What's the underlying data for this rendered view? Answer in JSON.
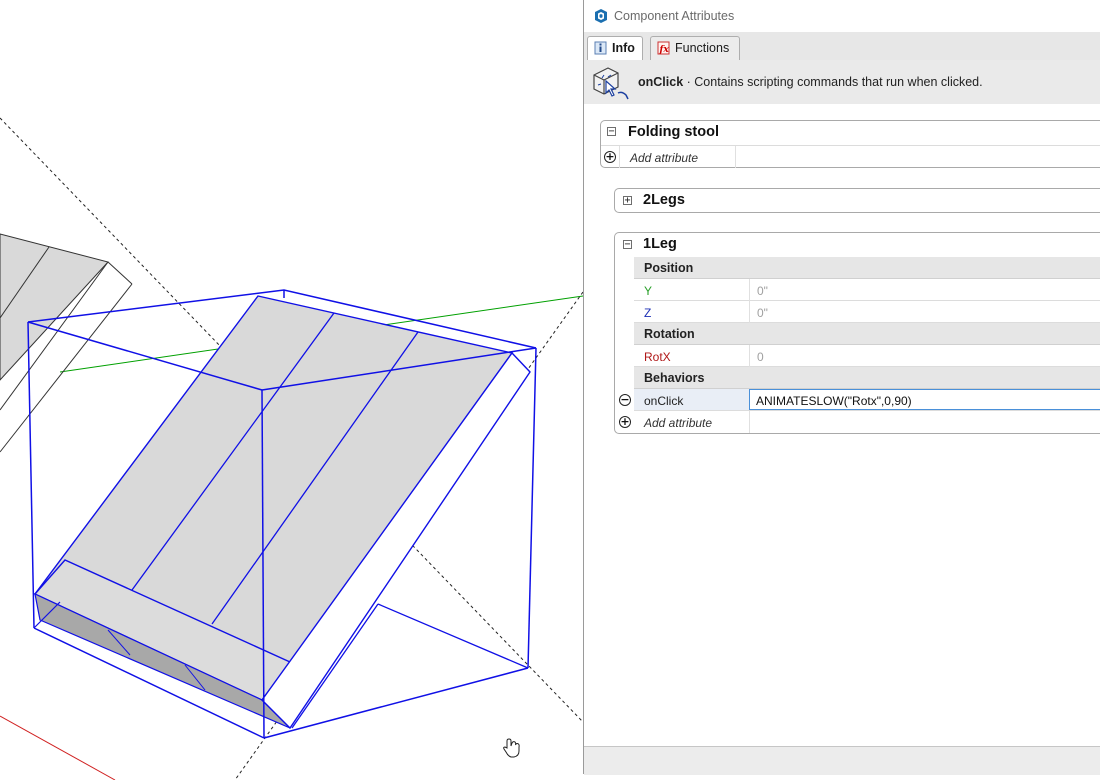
{
  "dialog": {
    "title": "Component Attributes",
    "tabs": [
      {
        "label": "Info",
        "icon": "info-icon",
        "active": true
      },
      {
        "label": "Functions",
        "icon": "fx-icon",
        "active": false
      }
    ],
    "info": {
      "attribute": "onClick",
      "description": " · Contains scripting commands that run when clicked.",
      "icon": "hand-cursor-cube-icon"
    }
  },
  "components": [
    {
      "name": "Folding stool",
      "expanded": true,
      "add_attribute": "Add attribute"
    },
    {
      "name": "2Legs",
      "expanded": false
    },
    {
      "name": "1Leg",
      "expanded": true,
      "sections": [
        {
          "label": "Position",
          "rows": [
            {
              "name": "Y",
              "value": "0\"",
              "color": "#2aa02a"
            },
            {
              "name": "Z",
              "value": "0\"",
              "color": "#1d2fb5"
            }
          ]
        },
        {
          "label": "Rotation",
          "rows": [
            {
              "name": "RotX",
              "value": "0",
              "color": "#b01818"
            }
          ]
        },
        {
          "label": "Behaviors",
          "rows": [
            {
              "name": "onClick",
              "value": "ANIMATESLOW(\"Rotx\",0,90)",
              "color": "#222222",
              "selected": true
            }
          ]
        }
      ],
      "add_attribute": "Add attribute"
    }
  ],
  "colors": {
    "selection_blue": "#1010e6",
    "green_axis": "#00a000",
    "red_axis": "#d02020",
    "face_gray": "#d9d9d9",
    "selected_cell_border": "#4a90d9"
  },
  "viewport": {
    "model": "folding-stool-leg",
    "cursor": "hand-cursor-icon"
  }
}
